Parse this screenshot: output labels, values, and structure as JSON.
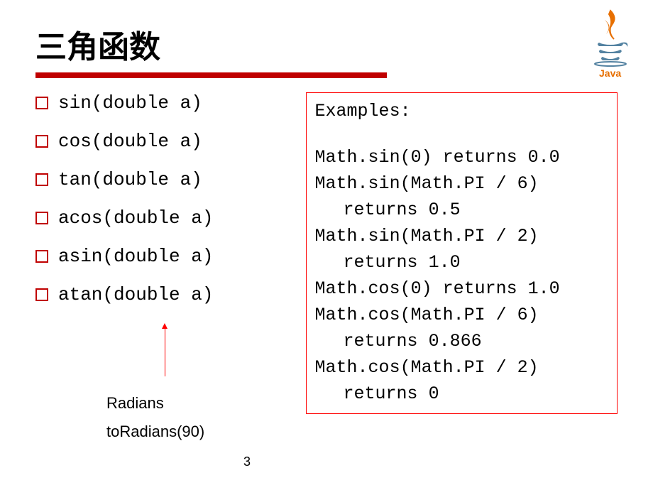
{
  "title": "三角函数",
  "functions": [
    "sin(double a)",
    "cos(double a)",
    "tan(double a)",
    "acos(double a)",
    "asin(double a)",
    "atan(double a)"
  ],
  "examples": {
    "heading": "Examples:",
    "lines": [
      {
        "text": "Math.sin(0) returns 0.0",
        "indent": false
      },
      {
        "text": "Math.sin(Math.PI / 6)",
        "indent": false
      },
      {
        "text": "returns 0.5",
        "indent": true
      },
      {
        "text": "Math.sin(Math.PI / 2)",
        "indent": false
      },
      {
        "text": "returns 1.0",
        "indent": true
      },
      {
        "text": "Math.cos(0) returns 1.0",
        "indent": false
      },
      {
        "text": "Math.cos(Math.PI / 6)",
        "indent": false
      },
      {
        "text": "returns 0.866",
        "indent": true
      },
      {
        "text": "Math.cos(Math.PI / 2)",
        "indent": false
      },
      {
        "text": "returns 0",
        "indent": true
      }
    ]
  },
  "annotations": {
    "radians": "Radians",
    "toRadians": "toRadians(90)"
  },
  "pageNumber": "3"
}
